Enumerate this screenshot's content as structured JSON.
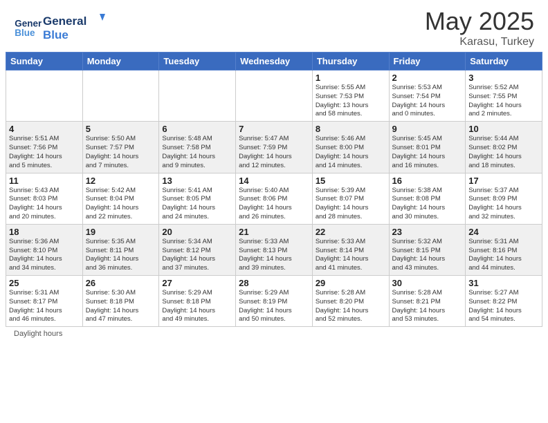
{
  "header": {
    "logo_line1": "General",
    "logo_line2": "Blue",
    "month": "May 2025",
    "location": "Karasu, Turkey"
  },
  "days_of_week": [
    "Sunday",
    "Monday",
    "Tuesday",
    "Wednesday",
    "Thursday",
    "Friday",
    "Saturday"
  ],
  "footer": {
    "text": "Daylight hours"
  },
  "weeks": [
    [
      {
        "day": "",
        "info": ""
      },
      {
        "day": "",
        "info": ""
      },
      {
        "day": "",
        "info": ""
      },
      {
        "day": "",
        "info": ""
      },
      {
        "day": "1",
        "info": "Sunrise: 5:55 AM\nSunset: 7:53 PM\nDaylight: 13 hours\nand 58 minutes."
      },
      {
        "day": "2",
        "info": "Sunrise: 5:53 AM\nSunset: 7:54 PM\nDaylight: 14 hours\nand 0 minutes."
      },
      {
        "day": "3",
        "info": "Sunrise: 5:52 AM\nSunset: 7:55 PM\nDaylight: 14 hours\nand 2 minutes."
      }
    ],
    [
      {
        "day": "4",
        "info": "Sunrise: 5:51 AM\nSunset: 7:56 PM\nDaylight: 14 hours\nand 5 minutes."
      },
      {
        "day": "5",
        "info": "Sunrise: 5:50 AM\nSunset: 7:57 PM\nDaylight: 14 hours\nand 7 minutes."
      },
      {
        "day": "6",
        "info": "Sunrise: 5:48 AM\nSunset: 7:58 PM\nDaylight: 14 hours\nand 9 minutes."
      },
      {
        "day": "7",
        "info": "Sunrise: 5:47 AM\nSunset: 7:59 PM\nDaylight: 14 hours\nand 12 minutes."
      },
      {
        "day": "8",
        "info": "Sunrise: 5:46 AM\nSunset: 8:00 PM\nDaylight: 14 hours\nand 14 minutes."
      },
      {
        "day": "9",
        "info": "Sunrise: 5:45 AM\nSunset: 8:01 PM\nDaylight: 14 hours\nand 16 minutes."
      },
      {
        "day": "10",
        "info": "Sunrise: 5:44 AM\nSunset: 8:02 PM\nDaylight: 14 hours\nand 18 minutes."
      }
    ],
    [
      {
        "day": "11",
        "info": "Sunrise: 5:43 AM\nSunset: 8:03 PM\nDaylight: 14 hours\nand 20 minutes."
      },
      {
        "day": "12",
        "info": "Sunrise: 5:42 AM\nSunset: 8:04 PM\nDaylight: 14 hours\nand 22 minutes."
      },
      {
        "day": "13",
        "info": "Sunrise: 5:41 AM\nSunset: 8:05 PM\nDaylight: 14 hours\nand 24 minutes."
      },
      {
        "day": "14",
        "info": "Sunrise: 5:40 AM\nSunset: 8:06 PM\nDaylight: 14 hours\nand 26 minutes."
      },
      {
        "day": "15",
        "info": "Sunrise: 5:39 AM\nSunset: 8:07 PM\nDaylight: 14 hours\nand 28 minutes."
      },
      {
        "day": "16",
        "info": "Sunrise: 5:38 AM\nSunset: 8:08 PM\nDaylight: 14 hours\nand 30 minutes."
      },
      {
        "day": "17",
        "info": "Sunrise: 5:37 AM\nSunset: 8:09 PM\nDaylight: 14 hours\nand 32 minutes."
      }
    ],
    [
      {
        "day": "18",
        "info": "Sunrise: 5:36 AM\nSunset: 8:10 PM\nDaylight: 14 hours\nand 34 minutes."
      },
      {
        "day": "19",
        "info": "Sunrise: 5:35 AM\nSunset: 8:11 PM\nDaylight: 14 hours\nand 36 minutes."
      },
      {
        "day": "20",
        "info": "Sunrise: 5:34 AM\nSunset: 8:12 PM\nDaylight: 14 hours\nand 37 minutes."
      },
      {
        "day": "21",
        "info": "Sunrise: 5:33 AM\nSunset: 8:13 PM\nDaylight: 14 hours\nand 39 minutes."
      },
      {
        "day": "22",
        "info": "Sunrise: 5:33 AM\nSunset: 8:14 PM\nDaylight: 14 hours\nand 41 minutes."
      },
      {
        "day": "23",
        "info": "Sunrise: 5:32 AM\nSunset: 8:15 PM\nDaylight: 14 hours\nand 43 minutes."
      },
      {
        "day": "24",
        "info": "Sunrise: 5:31 AM\nSunset: 8:16 PM\nDaylight: 14 hours\nand 44 minutes."
      }
    ],
    [
      {
        "day": "25",
        "info": "Sunrise: 5:31 AM\nSunset: 8:17 PM\nDaylight: 14 hours\nand 46 minutes."
      },
      {
        "day": "26",
        "info": "Sunrise: 5:30 AM\nSunset: 8:18 PM\nDaylight: 14 hours\nand 47 minutes."
      },
      {
        "day": "27",
        "info": "Sunrise: 5:29 AM\nSunset: 8:18 PM\nDaylight: 14 hours\nand 49 minutes."
      },
      {
        "day": "28",
        "info": "Sunrise: 5:29 AM\nSunset: 8:19 PM\nDaylight: 14 hours\nand 50 minutes."
      },
      {
        "day": "29",
        "info": "Sunrise: 5:28 AM\nSunset: 8:20 PM\nDaylight: 14 hours\nand 52 minutes."
      },
      {
        "day": "30",
        "info": "Sunrise: 5:28 AM\nSunset: 8:21 PM\nDaylight: 14 hours\nand 53 minutes."
      },
      {
        "day": "31",
        "info": "Sunrise: 5:27 AM\nSunset: 8:22 PM\nDaylight: 14 hours\nand 54 minutes."
      }
    ]
  ]
}
